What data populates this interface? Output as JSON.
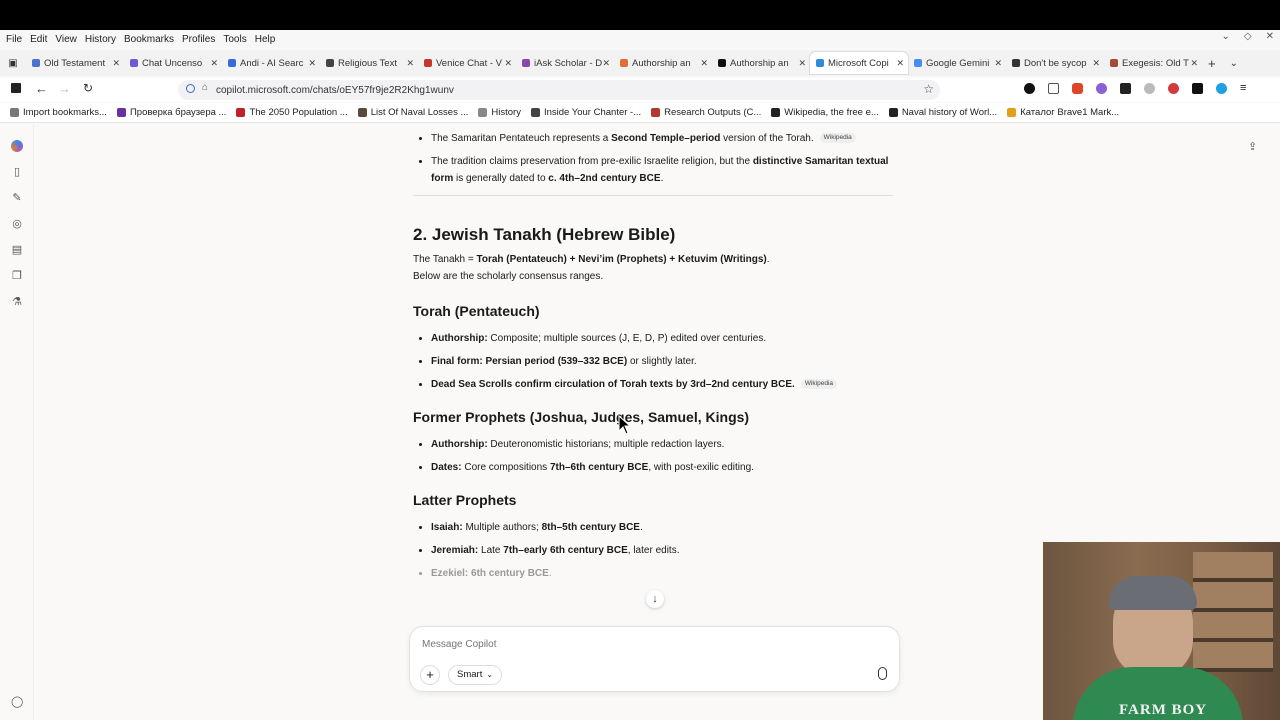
{
  "browser": {
    "menu": [
      "File",
      "Edit",
      "View",
      "History",
      "Bookmarks",
      "Profiles",
      "Tools",
      "Help"
    ],
    "tabs": [
      {
        "label": "Old Testament",
        "color": "#4a73c9"
      },
      {
        "label": "Chat Uncenso",
        "color": "#6b5bd6"
      },
      {
        "label": "Andi - AI Searc",
        "color": "#3a6ad4"
      },
      {
        "label": "Religious Text",
        "color": "#444444"
      },
      {
        "label": "Venice Chat - V",
        "color": "#c0392b"
      },
      {
        "label": "iAsk Scholar - D",
        "color": "#8e44ad"
      },
      {
        "label": "Authorship an",
        "color": "#e46b3a"
      },
      {
        "label": "Authorship an",
        "color": "#111111"
      },
      {
        "label": "Microsoft Copi",
        "color": "#2f8cd8"
      },
      {
        "label": "Google Gemini",
        "color": "#4a8af4"
      },
      {
        "label": "Don't be sycop",
        "color": "#333333"
      },
      {
        "label": "Exegesis: Old T",
        "color": "#a04d3a"
      }
    ],
    "url": "copilot.microsoft.com/chats/oEY57fr9je2R2Khg1wunv",
    "bookmarks": [
      {
        "label": "Import bookmarks...",
        "color": "#777777"
      },
      {
        "label": "Проверка браузера ...",
        "color": "#6b2fa0"
      },
      {
        "label": "The 2050 Population ...",
        "color": "#c0202a"
      },
      {
        "label": "List Of Naval Losses ...",
        "color": "#5a4a3a"
      },
      {
        "label": "History",
        "color": "#888888"
      },
      {
        "label": "Inside Your Chanter -...",
        "color": "#444444"
      },
      {
        "label": "Research Outputs (C...",
        "color": "#b03a2e"
      },
      {
        "label": "Wikipedia, the free e...",
        "color": "#222222"
      },
      {
        "label": "Naval history of Worl...",
        "color": "#222222"
      },
      {
        "label": "Каталог Brave1 Mark...",
        "color": "#e0a020"
      }
    ]
  },
  "chat": {
    "samaritan_items": [
      {
        "pre": "The Samaritan Pentateuch represents a ",
        "bold": "Second Temple–period",
        "post": " version of the Torah.",
        "source": "Wikipedia"
      },
      {
        "pre": "The tradition claims preservation from pre-exilic Israelite religion, but the ",
        "bold": "distinctive Samaritan textual form",
        "post": " is generally dated to ",
        "bold2": "c. 4th–2nd century BCE",
        "post2": "."
      }
    ],
    "section_title": "2. Jewish Tanakh (Hebrew Bible)",
    "intro_pre": "The Tanakh = ",
    "intro_bold": "Torah (Pentateuch) + Nevi’im (Prophets) + Ketuvim (Writings)",
    "intro_post": ".",
    "intro_line2": "Below are the scholarly consensus ranges.",
    "torah_title": "Torah (Pentateuch)",
    "torah_items": [
      {
        "label": "Authorship:",
        "text": " Composite; multiple sources (J, E, D, P) edited over centuries."
      },
      {
        "label": "Final form:",
        "bold": " Persian period (539–332 BCE)",
        "text": " or slightly later."
      },
      {
        "label": "Dead Sea Scrolls confirm circulation of Torah texts by 3rd–2nd century BCE.",
        "text": "",
        "source": "Wikipedia"
      }
    ],
    "former_title": "Former Prophets (Joshua, Judges, Samuel, Kings)",
    "former_items": [
      {
        "label": "Authorship:",
        "text": " Deuteronomistic historians; multiple redaction layers."
      },
      {
        "label": "Dates:",
        "text": " Core compositions ",
        "bold": "7th–6th century BCE",
        "post": ", with post-exilic editing."
      }
    ],
    "latter_title": "Latter Prophets",
    "latter_items": [
      {
        "label": "Isaiah:",
        "text": " Multiple authors; ",
        "bold": "8th–5th century BCE",
        "post": "."
      },
      {
        "label": "Jeremiah:",
        "text": " Late ",
        "bold": "7th–early 6th century BCE",
        "post": ", later edits."
      },
      {
        "label": "Ezekiel:",
        "text": " ",
        "bold": "6th century BCE",
        "post": "."
      }
    ]
  },
  "composer": {
    "placeholder": "Message Copilot",
    "mode": "Smart"
  },
  "webcam": {
    "shirt_text": "FARM BOY"
  }
}
